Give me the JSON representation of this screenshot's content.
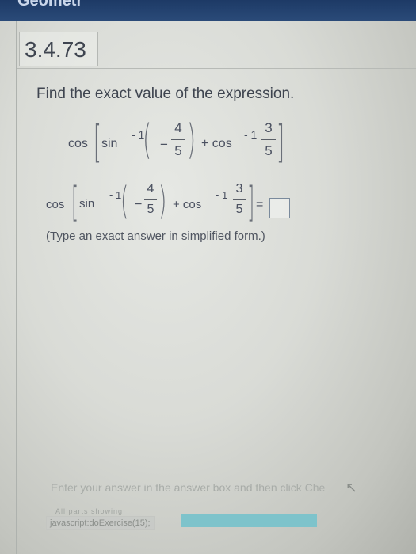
{
  "app": {
    "top_title": "Geometr"
  },
  "problem": {
    "number": "3.4.73",
    "instruction": "Find the exact value of the expression.",
    "note": "(Type an exact answer in simplified form.)"
  },
  "expression": {
    "cos": "cos",
    "sin": "sin",
    "exp": "- 1",
    "minus": "−",
    "plus": "+ cos",
    "num1": "4",
    "den1": "5",
    "num2": "3",
    "den2": "5",
    "equals": "="
  },
  "footer": {
    "enter_text": "Enter your answer in the answer box and then click Che",
    "all_parts": "All parts showing",
    "status_url": "javascript:doExercise(15);"
  }
}
